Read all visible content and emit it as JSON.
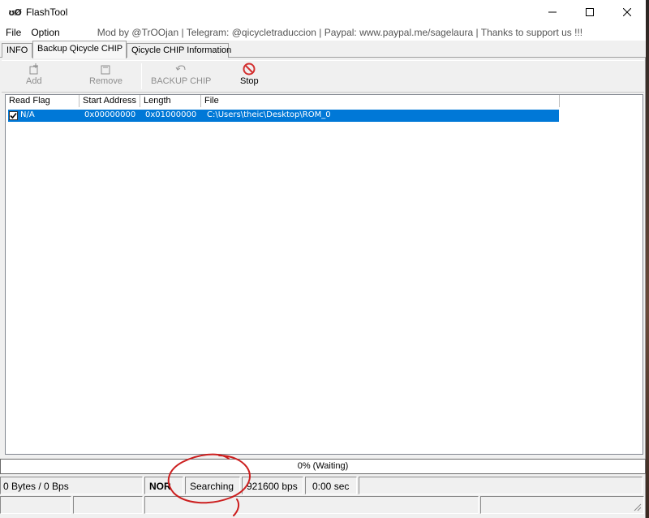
{
  "window": {
    "title": "FlashTool",
    "app_icon_glyph": "ʊØ"
  },
  "menu": {
    "items": [
      "File",
      "Option"
    ],
    "credits": "Mod by @TrOOjan | Telegram: @qicycletraduccion | Paypal: www.paypal.me/sagelaura | Thanks to support us !!!"
  },
  "tabs": [
    {
      "label": "INFO",
      "active": false
    },
    {
      "label": "Backup Qicycle CHIP",
      "active": true
    },
    {
      "label": "Qicycle CHIP Information",
      "active": false
    }
  ],
  "toolbar": {
    "add_label": "Add",
    "remove_label": "Remove",
    "backup_label": "BACKUP CHIP",
    "stop_label": "Stop",
    "stop_color": "#d32f2f"
  },
  "table": {
    "columns": [
      "Read Flag",
      "Start Address",
      "Length",
      "File"
    ],
    "rows": [
      {
        "checked": true,
        "read_flag": "N/A",
        "start_address": "0x00000000",
        "length": "0x01000000",
        "file": "C:\\Users\\theic\\Desktop\\ROM_0"
      }
    ],
    "selected_color": "#0078d7"
  },
  "progress": {
    "text": "0% (Waiting)",
    "value_percent": 0
  },
  "status": {
    "bytes": "0 Bytes / 0 Bps",
    "chip_type": "NOR",
    "state": "Searching",
    "baud": "921600 bps",
    "time": "0:00 sec"
  },
  "annotation": {
    "color": "#cc1f1f"
  }
}
